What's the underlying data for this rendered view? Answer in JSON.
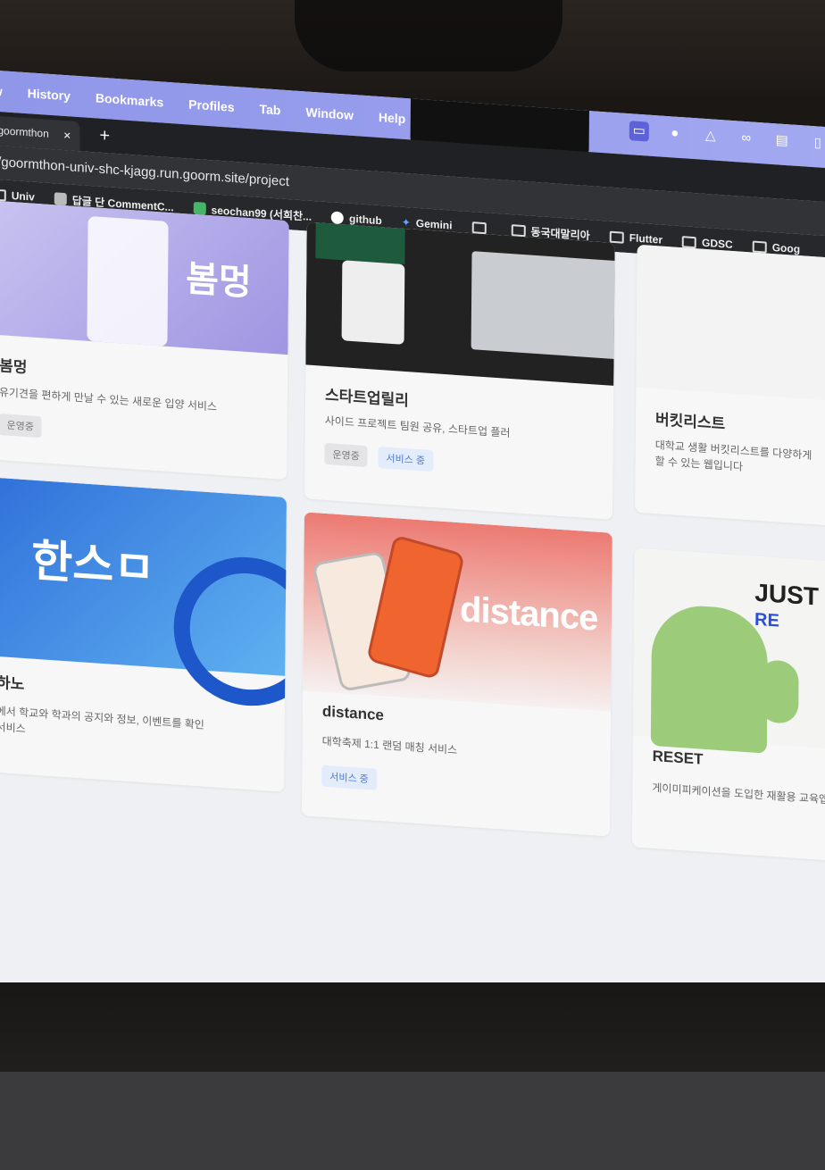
{
  "browser": {
    "menu": [
      "w",
      "History",
      "Bookmarks",
      "Profiles",
      "Tab",
      "Window",
      "Help"
    ],
    "tab_title": "goormthon",
    "tab_close": "×",
    "new_tab": "+",
    "url": "/goormthon-univ-shc-kjagg.run.goorm.site/project",
    "bookmarks": [
      {
        "label": "Univ",
        "icon": "folder-icon"
      },
      {
        "label": "답글 단 CommentC...",
        "icon": "page-icon"
      },
      {
        "label": "seochan99 (서희찬...",
        "icon": "v-icon"
      },
      {
        "label": "github",
        "icon": "github-icon"
      },
      {
        "label": "Gemini",
        "icon": "gemini-icon"
      },
      {
        "label": "",
        "icon": "folder-icon"
      },
      {
        "label": "동국대말리아",
        "icon": "folder-icon"
      },
      {
        "label": "Flutter",
        "icon": "folder-icon"
      },
      {
        "label": "GDSC",
        "icon": "folder-icon"
      },
      {
        "label": "Goog",
        "icon": "folder-icon"
      }
    ]
  },
  "projects": [
    {
      "thumb_text": "봄멍",
      "title": "봄멍",
      "desc": "유기견을 편하게 만날 수 있는 새로운 입양 서비스",
      "badges": [
        {
          "label": "운영중",
          "tone": "gray"
        }
      ]
    },
    {
      "thumb_text": "",
      "title": "스타트업릴리",
      "desc": "사이드 프로젝트 팀원 공유, 스타트업 플러",
      "badges": [
        {
          "label": "운영중",
          "tone": "gray"
        },
        {
          "label": "서비스 중",
          "tone": "blue"
        }
      ]
    },
    {
      "thumb_text": "",
      "title": "버킷리스트",
      "desc": "대학교 생활 버킷리스트를 다양하게",
      "desc2": "할 수 있는 웹입니다",
      "badges": []
    },
    {
      "thumb_text": "한스ㅁ",
      "title": "하노",
      "desc": "에서 학교와 학과의 공지와 정보, 이벤트를 확인",
      "desc2": "서비스",
      "badges": []
    },
    {
      "thumb_text": "distance",
      "title": "distance",
      "desc": "대학축제 1:1 랜덤 매칭 서비스",
      "badges": [
        {
          "label": "서비스 중",
          "tone": "blue"
        }
      ]
    },
    {
      "thumb_text": "JUST",
      "thumb_sub": "RE",
      "title": "RESET",
      "desc": "게이미피케이션을 도입한 재활용 교육앱",
      "badges": []
    }
  ]
}
